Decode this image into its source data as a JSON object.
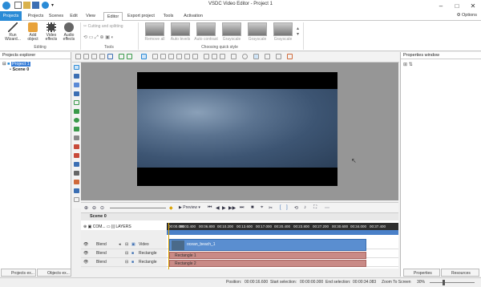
{
  "titlebar": {
    "title": "VSDC Video Editor - Project 1"
  },
  "menubar": {
    "items": [
      "Projects",
      "Scenes",
      "Edit",
      "View",
      "Editor",
      "Export project",
      "Tools",
      "Activation"
    ],
    "options": "Options"
  },
  "ribbon": {
    "editing": {
      "run_wizard": "Run Wizard...",
      "add_object": "Add object",
      "video_effects": "Video effects",
      "audio_effects": "Audio effects",
      "label": "Editing"
    },
    "tools": {
      "cutting": "Cutting and splitting",
      "label": "Tools"
    },
    "quick_style": {
      "label": "Choosing quick style",
      "styles": [
        "Remove all",
        "Auto levels",
        "Auto contrast",
        "Grayscale",
        "Grayscale",
        "Grayscale"
      ]
    }
  },
  "projects_explorer": {
    "title": "Projects explorer",
    "project": "Project 1",
    "scene": "Scene 0"
  },
  "properties_window": {
    "title": "Properties window"
  },
  "playback": {
    "preview": "Preview"
  },
  "timeline": {
    "scene_tab": "Scene 0",
    "com_label": "COM...",
    "layers_label": "LAYERS",
    "ticks": [
      "00:00.000",
      "00:03.400",
      "00:06.800",
      "00:10.200",
      "00:13.600",
      "00:17.000",
      "00:20.400",
      "00:23.800",
      "00:27.200",
      "00:30.600",
      "00:34.000",
      "00:37.400"
    ],
    "tracks": [
      {
        "blend": "Blend",
        "name": "Video",
        "clip": "ocean_beach_1"
      },
      {
        "blend": "Blend",
        "name": "Rectangle",
        "clip": "Rectangle 1"
      },
      {
        "blend": "Blend",
        "name": "Rectangle",
        "clip": "Rectangle 2"
      }
    ]
  },
  "bottom_tabs": {
    "projects": "Projects ex...",
    "objects": "Objects ex...",
    "properties": "Properties wi...",
    "resources": "Resources wi..."
  },
  "status": {
    "position_label": "Position:",
    "position": "00:00:16.600",
    "start_label": "Start selection:",
    "start": "00:00:00.000",
    "end_label": "End selection:",
    "end": "00:00:34.083",
    "zoom_label": "Zoom To Screen",
    "zoom": "30%"
  },
  "colors": {
    "accent": "#2a8bd6",
    "video_clip": "#5a8ed0",
    "rect_clip": "#c98a86",
    "ruler": "#2e2e2e"
  }
}
